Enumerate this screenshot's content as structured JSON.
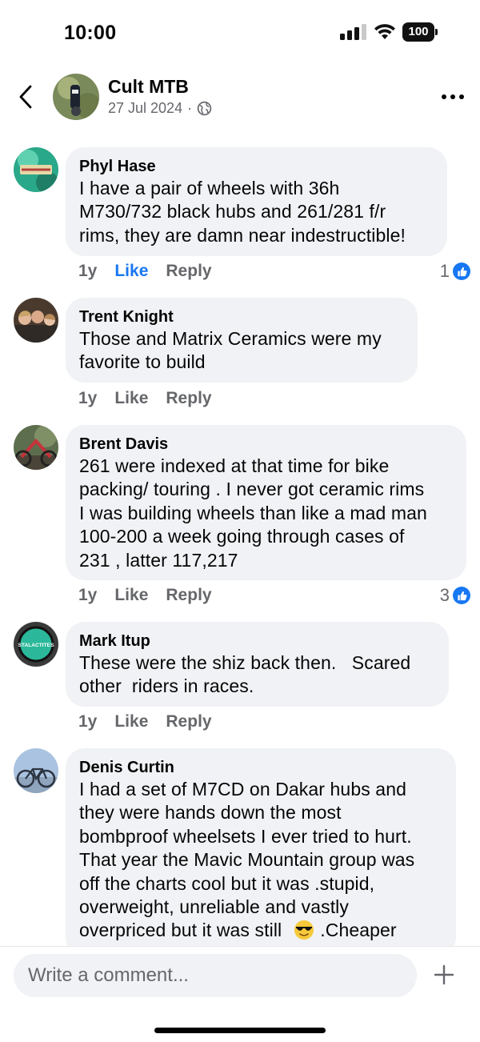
{
  "status_bar": {
    "time": "10:00",
    "battery": "100"
  },
  "header": {
    "page_name": "Cult MTB",
    "date": "27 Jul 2024",
    "separator": "·"
  },
  "comments": [
    {
      "author": "Phyl Hase",
      "lines": [
        "I have a pair of wheels with 36h",
        "M730/732 black hubs and 261/281 f/r",
        "rims, they are damn near indestructible!"
      ],
      "time": "1y",
      "like": "Like",
      "reply": "Reply",
      "reactions": "1",
      "liked": true
    },
    {
      "author": "Trent Knight",
      "lines": [
        "Those and Matrix Ceramics were my",
        "favorite to build"
      ],
      "time": "1y",
      "like": "Like",
      "reply": "Reply"
    },
    {
      "author": "Brent Davis",
      "lines": [
        "261 were indexed at that time for bike",
        "packing/ touring . I never got ceramic rims",
        "I was building wheels than like a mad man",
        "100-200 a week going through cases of",
        "231 , latter 117,217"
      ],
      "time": "1y",
      "like": "Like",
      "reply": "Reply",
      "reactions": "3"
    },
    {
      "author": "Mark Itup",
      "lines": [
        "These were the shiz back then.   Scared",
        "other  riders in races."
      ],
      "time": "1y",
      "like": "Like",
      "reply": "Reply"
    },
    {
      "author": "Denis Curtin",
      "lines": [
        "I had a set of M7CD on Dakar hubs and",
        "they were hands down the most",
        "bombproof wheelsets I ever tried to hurt.",
        "That year the Mavic Mountain group was",
        "off the charts cool but it was .stupid,",
        "overweight, unreliable and vastly",
        "overpriced but it was still",
        ".Cheaper"
      ]
    }
  ],
  "avatar_texts": {
    "mark": "STALACTITES"
  },
  "composer": {
    "placeholder": "Write a comment..."
  },
  "colors": {
    "accent": "#1877f2",
    "bubble": "#f0f2f5",
    "muted": "#65676b"
  },
  "icons": [
    "back-chevron-icon",
    "globe-icon",
    "more-dots-icon",
    "like-thumb-icon",
    "sunglasses-emoji-icon",
    "plus-icon"
  ]
}
